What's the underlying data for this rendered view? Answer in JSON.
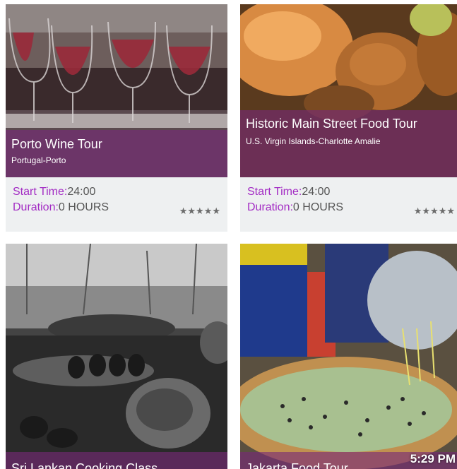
{
  "cards": [
    {
      "title": "Porto Wine Tour",
      "location": "Portugal-Porto",
      "start_label": "Start Time:",
      "start_value": "24:00",
      "duration_label": "Duration:",
      "duration_value": "0 HOURS",
      "rating": 5
    },
    {
      "title": "Historic Main Street Food Tour",
      "location": "U.S. Virgin Islands-Charlotte Amalie",
      "start_label": "Start Time:",
      "start_value": "24:00",
      "duration_label": "Duration:",
      "duration_value": "0 HOURS",
      "rating": 5
    },
    {
      "title": "Sri Lankan Cooking Class"
    },
    {
      "title": "Jakarta Food Tour"
    }
  ],
  "status_bar": {
    "time": "5:29 PM"
  },
  "colors": {
    "overlay": "#782878",
    "label": "#a32cc4",
    "value": "#555555"
  }
}
